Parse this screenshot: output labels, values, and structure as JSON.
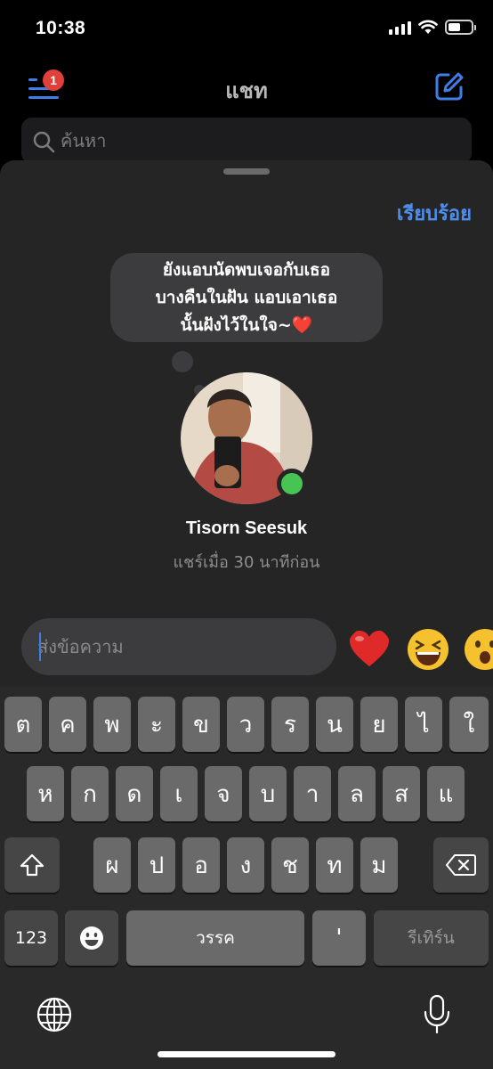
{
  "status": {
    "time": "10:38"
  },
  "header": {
    "title": "แชท",
    "badge_count": "1"
  },
  "search": {
    "placeholder": "ค้นหา"
  },
  "sheet": {
    "done_label": "เรียบร้อย",
    "note_lines": [
      "ยังแอบนัดพบเจอกับเธอ",
      "บางคืนในฝัน แอบเอาเธอ",
      "นั้นฝังไว้ในใจ~❤️"
    ],
    "user_name": "Tisorn Seesuk",
    "shared_time": "แชร์เมื่อ 30 นาทีก่อน",
    "message_placeholder": "ส่งข้อความ",
    "quick_reactions": [
      "heart",
      "laughing-face",
      "surprised-face"
    ]
  },
  "keyboard": {
    "row1": [
      "ต",
      "ค",
      "พ",
      "ะ",
      "ข",
      "ว",
      "ร",
      "น",
      "ย",
      "ไ",
      "ใ"
    ],
    "row2": [
      "ห",
      "ก",
      "ด",
      "เ",
      "จ",
      "บ",
      "า",
      "ล",
      "ส",
      "แ"
    ],
    "row3": [
      "ผ",
      "ป",
      "อ",
      "ง",
      "ช",
      "ท",
      "ม"
    ],
    "numbers_label": "123",
    "space_label": "วรรค",
    "apostrophe_label": "'",
    "return_label": "รีเทิร์น"
  },
  "colors": {
    "accent": "#3f7ee8",
    "badge": "#e0403a",
    "online": "#48c455",
    "sheet_bg": "#252525",
    "key_bg": "#6a6a6a"
  }
}
